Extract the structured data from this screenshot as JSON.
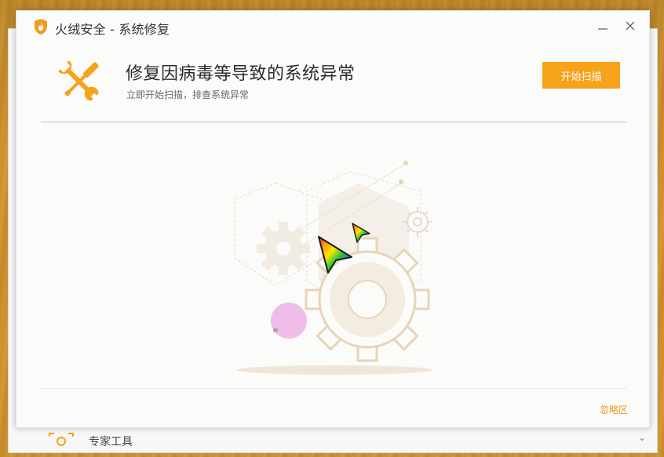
{
  "window": {
    "title": "火绒安全 - 系统修复"
  },
  "header": {
    "headline": "修复因病毒等导致的系统异常",
    "subline": "立即开始扫描，排查系统异常",
    "scan_button": "开始扫描"
  },
  "footer": {
    "ignore_link": "忽略区"
  },
  "background_window": {
    "bottom_label": "专家工具"
  },
  "icons": {
    "app_logo": "huorong-shield-icon",
    "tool": "wrench-screwdriver-icon",
    "minimize": "minimize-icon",
    "close": "close-icon",
    "illustration": "gears-illustration",
    "cursors": "rainbow-cursor-icon"
  },
  "colors": {
    "accent": "#f6a21a",
    "link": "#e99a22",
    "dialog_bg": "#fbfbfa",
    "gear": "#e9dcc7"
  }
}
